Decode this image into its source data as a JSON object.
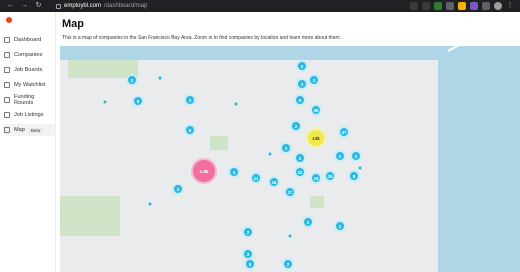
{
  "browser": {
    "domain": "employbl.com",
    "path": "/dashboard/map"
  },
  "sidebar": {
    "items": [
      {
        "label": "Dashboard"
      },
      {
        "label": "Companies"
      },
      {
        "label": "Job Boards"
      },
      {
        "label": "My Watchlist"
      },
      {
        "label": "Funding Rounds"
      },
      {
        "label": "Job Listings"
      },
      {
        "label": "Map",
        "badge": "Beta"
      }
    ]
  },
  "page": {
    "title": "Map",
    "description": "This is a map of companies in the San Francisco Bay Area. Zoom in to find companies by location and learn more about them."
  },
  "map": {
    "clusters": [
      {
        "label": "2",
        "kind": "small"
      },
      {
        "label": "5",
        "kind": "small"
      },
      {
        "label": "2",
        "kind": "small"
      },
      {
        "label": "9",
        "kind": "small"
      },
      {
        "label": "2",
        "kind": "small"
      },
      {
        "label": "3",
        "kind": "small"
      },
      {
        "label": "2",
        "kind": "small"
      },
      {
        "label": "6",
        "kind": "small"
      },
      {
        "label": "36",
        "kind": "small"
      },
      {
        "label": "2",
        "kind": "small"
      },
      {
        "label": "2",
        "kind": "small"
      },
      {
        "label": "13k",
        "kind": "yellow"
      },
      {
        "label": "47",
        "kind": "small"
      },
      {
        "label": "2",
        "kind": "small"
      },
      {
        "label": "32",
        "kind": "small"
      },
      {
        "label": "2",
        "kind": "small"
      },
      {
        "label": "3",
        "kind": "small"
      },
      {
        "label": "18",
        "kind": "small"
      },
      {
        "label": "17",
        "kind": "small"
      },
      {
        "label": "1.8k",
        "kind": "pink"
      },
      {
        "label": "4",
        "kind": "small"
      },
      {
        "label": "11",
        "kind": "small"
      },
      {
        "label": "16",
        "kind": "small"
      },
      {
        "label": "29",
        "kind": "small"
      },
      {
        "label": "8",
        "kind": "small"
      },
      {
        "label": "2",
        "kind": "small"
      },
      {
        "label": "2",
        "kind": "small"
      },
      {
        "label": "3",
        "kind": "small"
      },
      {
        "label": "2",
        "kind": "small"
      },
      {
        "label": "2",
        "kind": "small"
      },
      {
        "label": "5",
        "kind": "small"
      },
      {
        "label": "2",
        "kind": "small"
      }
    ]
  }
}
